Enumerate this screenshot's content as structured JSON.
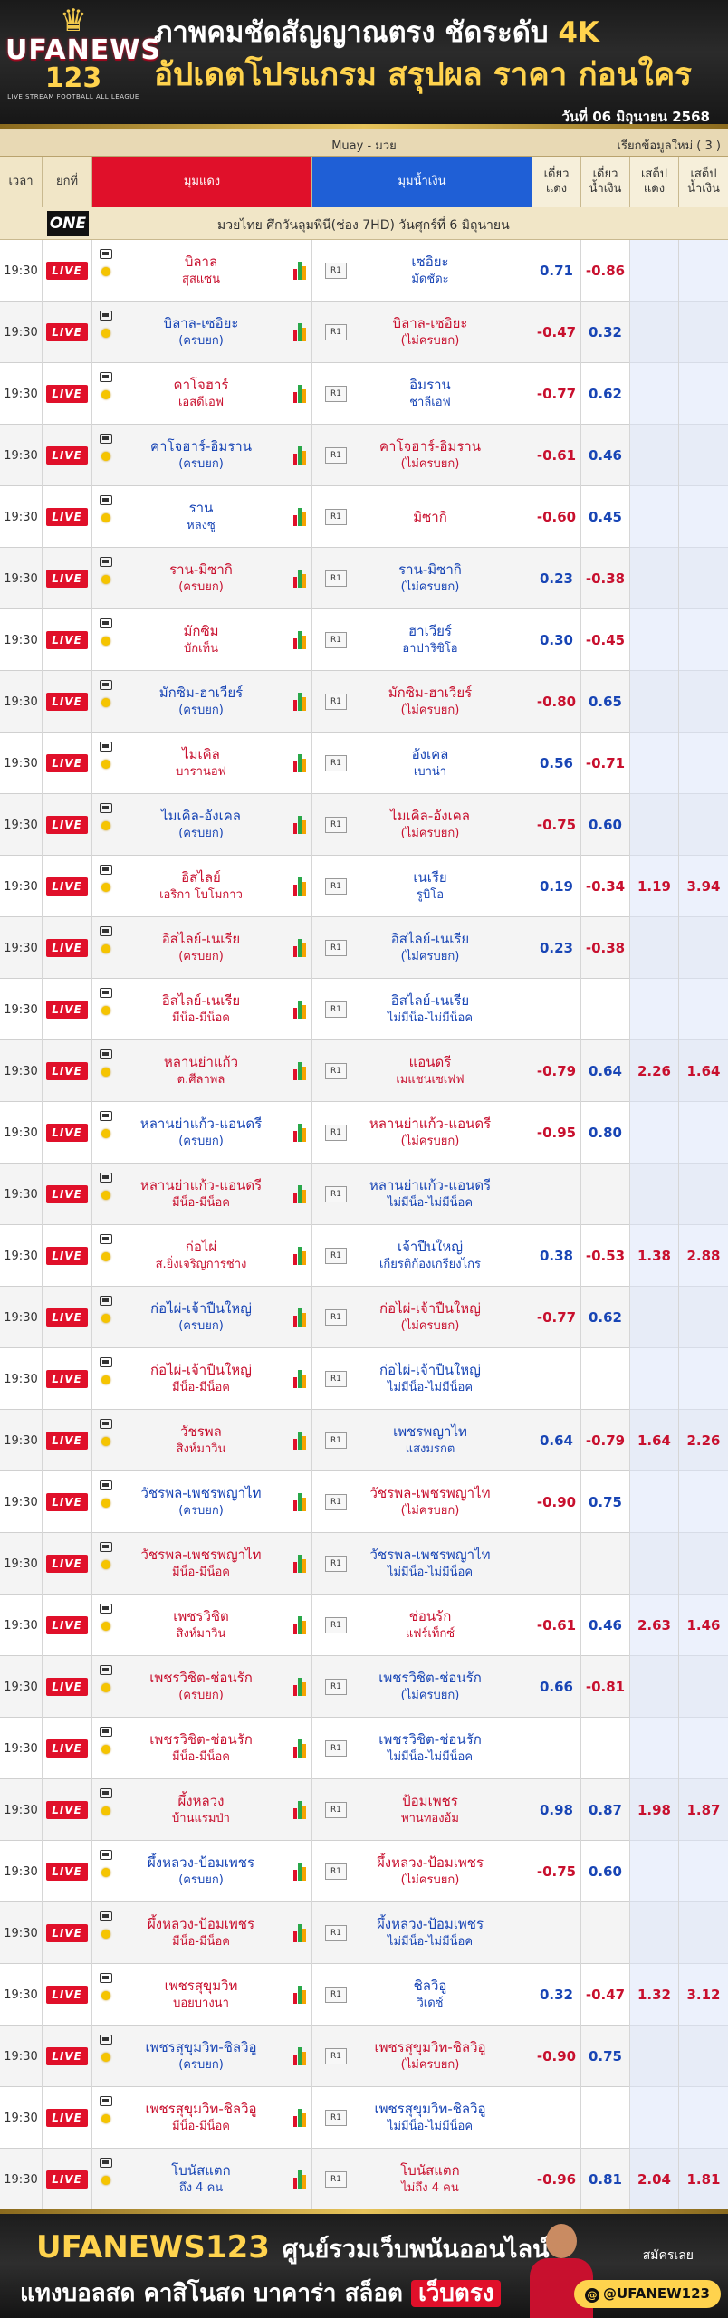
{
  "header": {
    "logo_top": "UFANEWS",
    "logo_num": "123",
    "logo_sub": "LIVE STREAM FOOTBALL ALL LEAGUE",
    "headline1_main": "ภาพคมชัดสัญญาณตรง ชัดระดับ ",
    "headline1_accent": "4K",
    "headline2": "อัปเดตโปรแกรม สรุปผล ราคา ก่อนใคร",
    "date": "วันที่ 06 มิถุนายน 2568"
  },
  "category": {
    "label": "Muay - มวย",
    "refresh": "เรียกข้อมูลใหม่ ( 3 )"
  },
  "columns": {
    "time": "เวลา",
    "channel": "ยกที่",
    "home": "มุมแดง",
    "away": "มุมน้ำเงิน",
    "odd1": "เดี่ยว แดง",
    "odd2": "เดี่ยว น้ำเงิน",
    "odd3": "เสต็ป แดง",
    "odd4": "เสต็ป น้ำเงิน"
  },
  "league": {
    "badge": "ONE",
    "name": "มวยไทย ศึกวันลุมพินี(ช่อง 7HD) วันศุกร์ที่ 6 มิถุนายน"
  },
  "live_label": "LIVE",
  "round_label": "R1",
  "rows": [
    {
      "time": "19:30",
      "h1": "บิลาล",
      "h2": "สุสแซน",
      "a1": "เซอิยะ",
      "a2": "มัดชัดะ",
      "o1": "0.71",
      "o2": "-0.86",
      "o3": "",
      "o4": "",
      "hfav": false,
      "ared": false
    },
    {
      "time": "19:30",
      "h1": "บิลาล-เซอิยะ",
      "h2": "(ครบยก)",
      "a1": "บิลาล-เซอิยะ",
      "a2": "(ไม่ครบยก)",
      "o1": "-0.47",
      "o2": "0.32",
      "o3": "",
      "o4": "",
      "hfav": true,
      "ared": true
    },
    {
      "time": "19:30",
      "h1": "คาโจฮาร์",
      "h2": "เอสดีเอฟ",
      "a1": "อิมราน",
      "a2": "ชาลีเอฟ",
      "o1": "-0.77",
      "o2": "0.62",
      "o3": "",
      "o4": "",
      "hfav": false,
      "ared": false
    },
    {
      "time": "19:30",
      "h1": "คาโจฮาร์-อิมราน",
      "h2": "(ครบยก)",
      "a1": "คาโจฮาร์-อิมราน",
      "a2": "(ไม่ครบยก)",
      "o1": "-0.61",
      "o2": "0.46",
      "o3": "",
      "o4": "",
      "hfav": true,
      "ared": true
    },
    {
      "time": "19:30",
      "h1": "ราน",
      "h2": "หลงซู",
      "a1": "มิซากิ",
      "a2": "",
      "o1": "-0.60",
      "o2": "0.45",
      "o3": "",
      "o4": "",
      "hfav": true,
      "ared": true
    },
    {
      "time": "19:30",
      "h1": "ราน-มิซากิ",
      "h2": "(ครบยก)",
      "a1": "ราน-มิซากิ",
      "a2": "(ไม่ครบยก)",
      "o1": "0.23",
      "o2": "-0.38",
      "o3": "",
      "o4": "",
      "hfav": false,
      "ared": false
    },
    {
      "time": "19:30",
      "h1": "มักซิม",
      "h2": "บักเท็น",
      "a1": "ฮาเวียร์",
      "a2": "อาปาริซิโอ",
      "o1": "0.30",
      "o2": "-0.45",
      "o3": "",
      "o4": "",
      "hfav": false,
      "ared": false
    },
    {
      "time": "19:30",
      "h1": "มักซิม-ฮาเวียร์",
      "h2": "(ครบยก)",
      "a1": "มักซิม-ฮาเวียร์",
      "a2": "(ไม่ครบยก)",
      "o1": "-0.80",
      "o2": "0.65",
      "o3": "",
      "o4": "",
      "hfav": true,
      "ared": true
    },
    {
      "time": "19:30",
      "h1": "ไมเคิล",
      "h2": "บารานอฟ",
      "a1": "อังเคล",
      "a2": "เบาน่า",
      "o1": "0.56",
      "o2": "-0.71",
      "o3": "",
      "o4": "",
      "hfav": false,
      "ared": false
    },
    {
      "time": "19:30",
      "h1": "ไมเคิล-อังเคล",
      "h2": "(ครบยก)",
      "a1": "ไมเคิล-อังเคล",
      "a2": "(ไม่ครบยก)",
      "o1": "-0.75",
      "o2": "0.60",
      "o3": "",
      "o4": "",
      "hfav": true,
      "ared": true
    },
    {
      "time": "19:30",
      "h1": "อิสไลย์",
      "h2": "เอริกา โบโมกาว",
      "a1": "เนเรีย",
      "a2": "รูบิโอ",
      "o1": "0.19",
      "o2": "-0.34",
      "o3": "1.19",
      "o4": "3.94",
      "hfav": false,
      "ared": false
    },
    {
      "time": "19:30",
      "h1": "อิสไลย์-เนเรีย",
      "h2": "(ครบยก)",
      "a1": "อิสไลย์-เนเรีย",
      "a2": "(ไม่ครบยก)",
      "o1": "0.23",
      "o2": "-0.38",
      "o3": "",
      "o4": "",
      "hfav": false,
      "ared": false
    },
    {
      "time": "19:30",
      "h1": "อิสไลย์-เนเรีย",
      "h2": "มีน็อ-มีน็อค",
      "a1": "อิสไลย์-เนเรีย",
      "a2": "ไม่มีน็อ-ไม่มีน็อค",
      "o1": "",
      "o2": "",
      "o3": "",
      "o4": "",
      "hfav": false,
      "ared": false
    },
    {
      "time": "19:30",
      "h1": "หลานย่าแก้ว",
      "h2": "ต.ศีลาพล",
      "a1": "แอนดรี",
      "a2": "เมแชนเซเฟฟ",
      "o1": "-0.79",
      "o2": "0.64",
      "o3": "2.26",
      "o4": "1.64",
      "hfav": false,
      "ared": true
    },
    {
      "time": "19:30",
      "h1": "หลานย่าแก้ว-แอนดรี",
      "h2": "(ครบยก)",
      "a1": "หลานย่าแก้ว-แอนดรี",
      "a2": "(ไม่ครบยก)",
      "o1": "-0.95",
      "o2": "0.80",
      "o3": "",
      "o4": "",
      "hfav": true,
      "ared": true
    },
    {
      "time": "19:30",
      "h1": "หลานย่าแก้ว-แอนดรี",
      "h2": "มีน็อ-มีน็อค",
      "a1": "หลานย่าแก้ว-แอนดรี",
      "a2": "ไม่มีน็อ-ไม่มีน็อค",
      "o1": "",
      "o2": "",
      "o3": "",
      "o4": "",
      "hfav": false,
      "ared": false
    },
    {
      "time": "19:30",
      "h1": "ก่อไผ่",
      "h2": "ส.ยิ่งเจริญการช่าง",
      "a1": "เจ้าปืนใหญ่",
      "a2": "เกียรติก้องเกรียงไกร",
      "o1": "0.38",
      "o2": "-0.53",
      "o3": "1.38",
      "o4": "2.88",
      "hfav": false,
      "ared": false
    },
    {
      "time": "19:30",
      "h1": "ก่อไผ่-เจ้าปืนใหญ่",
      "h2": "(ครบยก)",
      "a1": "ก่อไผ่-เจ้าปืนใหญ่",
      "a2": "(ไม่ครบยก)",
      "o1": "-0.77",
      "o2": "0.62",
      "o3": "",
      "o4": "",
      "hfav": true,
      "ared": true
    },
    {
      "time": "19:30",
      "h1": "ก่อไผ่-เจ้าปืนใหญ่",
      "h2": "มีน็อ-มีน็อค",
      "a1": "ก่อไผ่-เจ้าปืนใหญ่",
      "a2": "ไม่มีน็อ-ไม่มีน็อค",
      "o1": "",
      "o2": "",
      "o3": "",
      "o4": "",
      "hfav": false,
      "ared": false
    },
    {
      "time": "19:30",
      "h1": "วัชรพล",
      "h2": "สิงห์มาวิน",
      "a1": "เพชรพญาไท",
      "a2": "แสงมรกต",
      "o1": "0.64",
      "o2": "-0.79",
      "o3": "1.64",
      "o4": "2.26",
      "hfav": false,
      "ared": false
    },
    {
      "time": "19:30",
      "h1": "วัชรพล-เพชรพญาไท",
      "h2": "(ครบยก)",
      "a1": "วัชรพล-เพชรพญาไท",
      "a2": "(ไม่ครบยก)",
      "o1": "-0.90",
      "o2": "0.75",
      "o3": "",
      "o4": "",
      "hfav": true,
      "ared": true
    },
    {
      "time": "19:30",
      "h1": "วัชรพล-เพชรพญาไท",
      "h2": "มีน็อ-มีน็อค",
      "a1": "วัชรพล-เพชรพญาไท",
      "a2": "ไม่มีน็อ-ไม่มีน็อค",
      "o1": "",
      "o2": "",
      "o3": "",
      "o4": "",
      "hfav": false,
      "ared": false
    },
    {
      "time": "19:30",
      "h1": "เพชรวิชิต",
      "h2": "สิงห์มาวิน",
      "a1": "ช่อนรัก",
      "a2": "แฟร์เท็กซ์",
      "o1": "-0.61",
      "o2": "0.46",
      "o3": "2.63",
      "o4": "1.46",
      "hfav": false,
      "ared": true
    },
    {
      "time": "19:30",
      "h1": "เพชรวิชิต-ช่อนรัก",
      "h2": "(ครบยก)",
      "a1": "เพชรวิชิต-ช่อนรัก",
      "a2": "(ไม่ครบยก)",
      "o1": "0.66",
      "o2": "-0.81",
      "o3": "",
      "o4": "",
      "hfav": false,
      "ared": false
    },
    {
      "time": "19:30",
      "h1": "เพชรวิชิต-ช่อนรัก",
      "h2": "มีน็อ-มีน็อค",
      "a1": "เพชรวิชิต-ช่อนรัก",
      "a2": "ไม่มีน็อ-ไม่มีน็อค",
      "o1": "",
      "o2": "",
      "o3": "",
      "o4": "",
      "hfav": false,
      "ared": false
    },
    {
      "time": "19:30",
      "h1": "ผึ้งหลวง",
      "h2": "บ้านแรมป่า",
      "a1": "ป้อมเพชร",
      "a2": "พานทองอ้ม",
      "o1": "0.98",
      "o2": "0.87",
      "o3": "1.98",
      "o4": "1.87",
      "hfav": false,
      "ared": true
    },
    {
      "time": "19:30",
      "h1": "ผึ้งหลวง-ป้อมเพชร",
      "h2": "(ครบยก)",
      "a1": "ผึ้งหลวง-ป้อมเพชร",
      "a2": "(ไม่ครบยก)",
      "o1": "-0.75",
      "o2": "0.60",
      "o3": "",
      "o4": "",
      "hfav": true,
      "ared": true
    },
    {
      "time": "19:30",
      "h1": "ผึ้งหลวง-ป้อมเพชร",
      "h2": "มีน็อ-มีน็อค",
      "a1": "ผึ้งหลวง-ป้อมเพชร",
      "a2": "ไม่มีน็อ-ไม่มีน็อค",
      "o1": "",
      "o2": "",
      "o3": "",
      "o4": "",
      "hfav": false,
      "ared": false
    },
    {
      "time": "19:30",
      "h1": "เพชรสุขุมวิท",
      "h2": "บอยบางนา",
      "a1": "ชิลวิอู",
      "a2": "วิเดซ์",
      "o1": "0.32",
      "o2": "-0.47",
      "o3": "1.32",
      "o4": "3.12",
      "hfav": false,
      "ared": false
    },
    {
      "time": "19:30",
      "h1": "เพชรสุขุมวิท-ชิลวิอู",
      "h2": "(ครบยก)",
      "a1": "เพชรสุขุมวิท-ชิลวิอู",
      "a2": "(ไม่ครบยก)",
      "o1": "-0.90",
      "o2": "0.75",
      "o3": "",
      "o4": "",
      "hfav": true,
      "ared": true
    },
    {
      "time": "19:30",
      "h1": "เพชรสุขุมวิท-ชิลวิอู",
      "h2": "มีน็อ-มีน็อค",
      "a1": "เพชรสุขุมวิท-ชิลวิอู",
      "a2": "ไม่มีน็อ-ไม่มีน็อค",
      "o1": "",
      "o2": "",
      "o3": "",
      "o4": "",
      "hfav": false,
      "ared": false
    },
    {
      "time": "19:30",
      "h1": "โบนัสแตก",
      "h2": "ถึง 4 คน",
      "a1": "โบนัสแตก",
      "a2": "ไม่ถึง 4 คน",
      "o1": "-0.96",
      "o2": "0.81",
      "o3": "2.04",
      "o4": "1.81",
      "hfav": true,
      "ared": true
    }
  ],
  "footer": {
    "brand": "UFANEWS123",
    "tagline": "ศูนย์รวมเว็บพนันออนไลน์",
    "line2_main": "แทงบอลสด คาสิโนสด บาคาร่า สล็อต",
    "line2_pill": "เว็บตรง",
    "join": "สมัครเลย",
    "handle": "@UFANEW123"
  }
}
